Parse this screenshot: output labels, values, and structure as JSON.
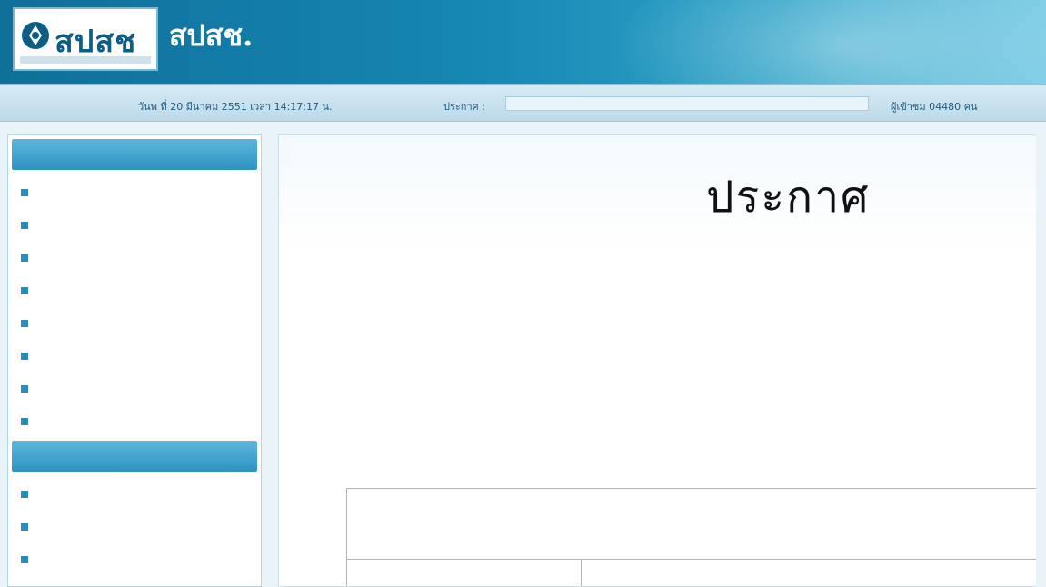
{
  "header": {
    "logo_text": "สปสช",
    "org_name": "สปสช.",
    "subtitle": "",
    "colors": {
      "primary": "#1686b3",
      "accent": "#1a57a3"
    }
  },
  "infobar": {
    "date_text": "วันพ ที่ 20 มีนาคม 2551 เวลา 14:17:17 น.",
    "announce_label": "ประกาศ :",
    "visits_text": "ผู้เข้าชม 04480 คน"
  },
  "sidebar": {
    "section1": {
      "title": "",
      "items": [
        {
          "label": ""
        },
        {
          "label": ""
        },
        {
          "label": ""
        },
        {
          "label": ""
        },
        {
          "label": ""
        },
        {
          "label": ""
        },
        {
          "label": ""
        },
        {
          "label": ""
        }
      ]
    },
    "section2": {
      "title": "",
      "items": [
        {
          "label": ""
        },
        {
          "label": ""
        },
        {
          "label": ""
        },
        {
          "label": ""
        }
      ]
    }
  },
  "main": {
    "page_title": "ประกาศ",
    "subject_prefix": "",
    "subject_link": "",
    "para1_big_link": "",
    "para2_link": "",
    "para4_link": "",
    "para5_link": "",
    "box_header_line1": "",
    "box_header_line2": "",
    "col1_header": "",
    "col2_header": ""
  }
}
